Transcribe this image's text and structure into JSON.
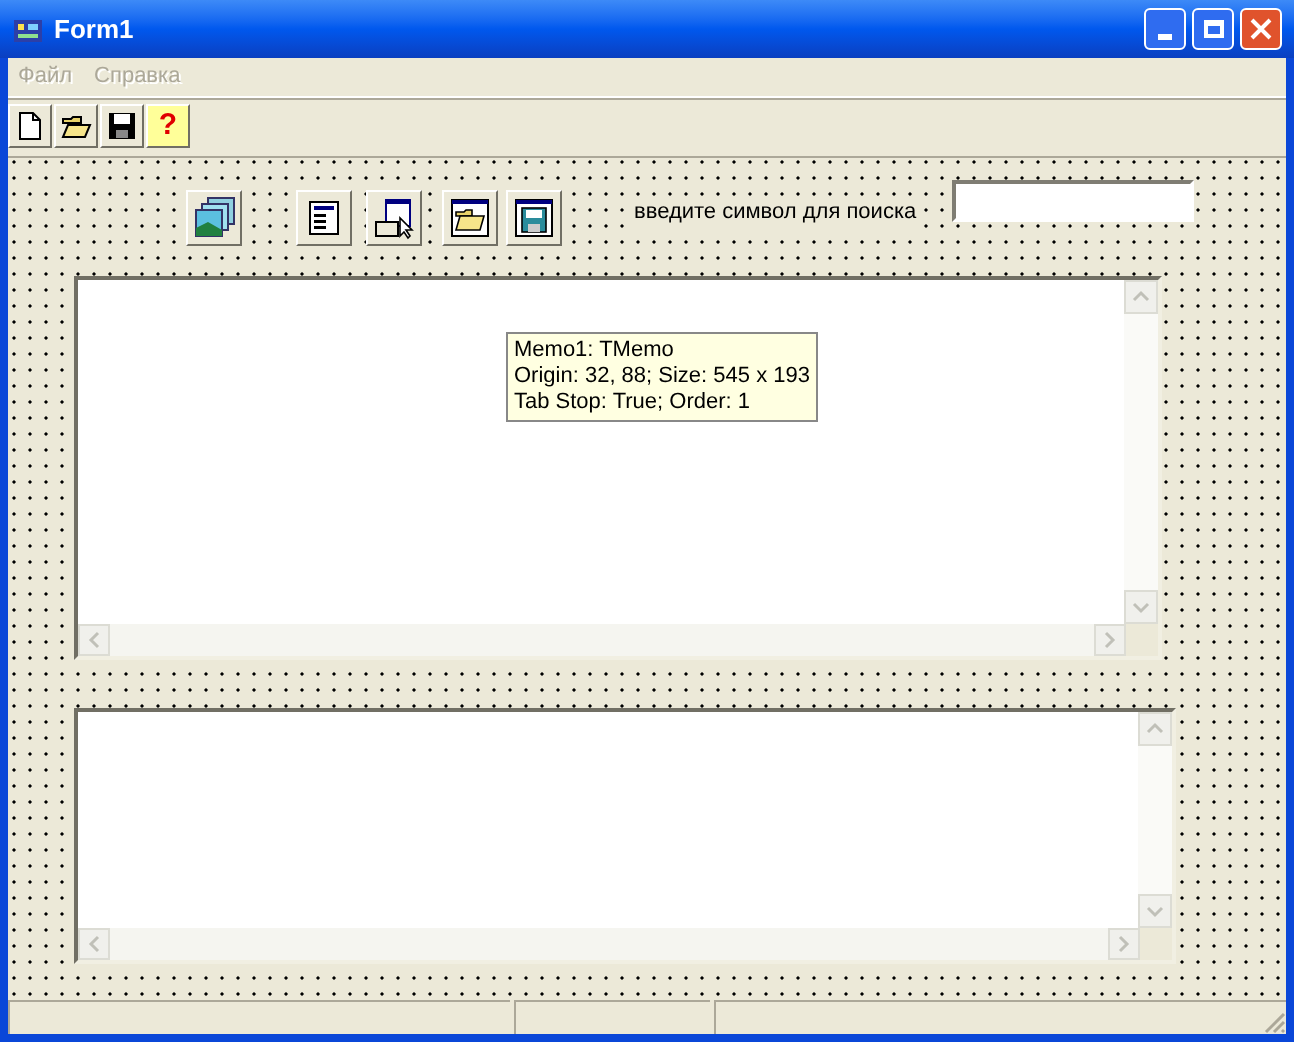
{
  "window": {
    "title": "Form1"
  },
  "menu": [
    {
      "label": "Файл",
      "disabled": true
    },
    {
      "label": "Справка",
      "disabled": true
    }
  ],
  "toolbar": [
    {
      "kind": "new"
    },
    {
      "kind": "open"
    },
    {
      "kind": "save"
    },
    {
      "kind": "help",
      "glyph": "?"
    }
  ],
  "components": [
    {
      "kind": "imagelist"
    },
    {
      "kind": "mainmenu"
    },
    {
      "kind": "dialog"
    },
    {
      "kind": "opendialog"
    },
    {
      "kind": "savedialog"
    }
  ],
  "search": {
    "label": "введите символ для поиска"
  },
  "tooltip": {
    "lines": [
      "Memo1: TMemo",
      "Origin: 32, 88; Size: 545 x 193",
      "Tab Stop: True; Order: 1"
    ]
  }
}
